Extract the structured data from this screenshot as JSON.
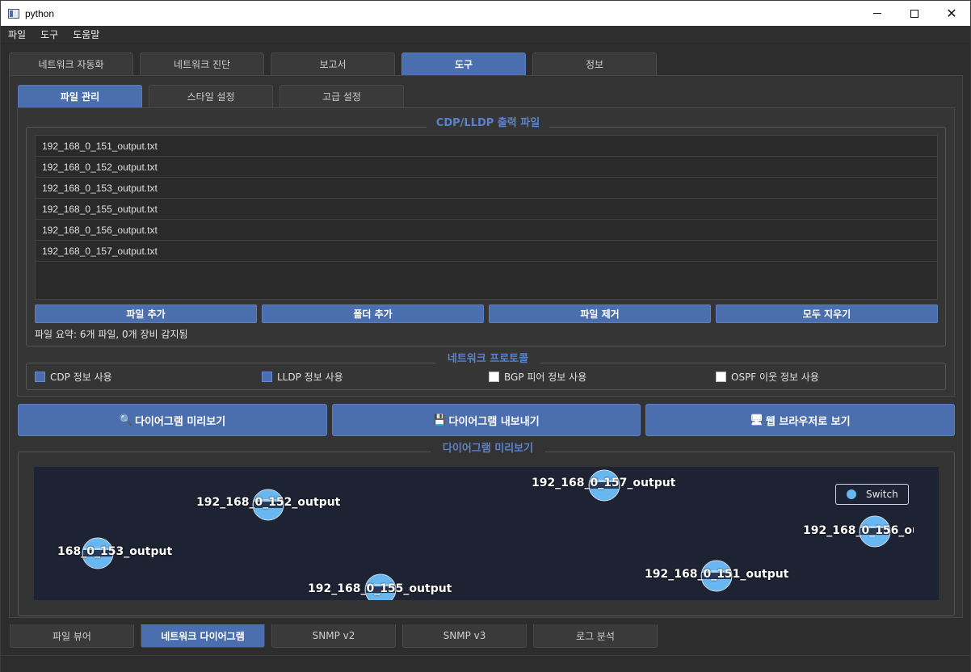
{
  "window": {
    "title": "python"
  },
  "menu": [
    "파일",
    "도구",
    "도움말"
  ],
  "main_tabs": [
    {
      "label": "네트워크 자동화",
      "active": false
    },
    {
      "label": "네트워크 진단",
      "active": false
    },
    {
      "label": "보고서",
      "active": false
    },
    {
      "label": "도구",
      "active": true
    },
    {
      "label": "정보",
      "active": false
    }
  ],
  "sub_tabs": [
    {
      "label": "파일 관리",
      "active": true
    },
    {
      "label": "스타일 설정",
      "active": false
    },
    {
      "label": "고급 설정",
      "active": false
    }
  ],
  "files_group": {
    "title": "CDP/LLDP 출력 파일",
    "files": [
      "192_168_0_151_output.txt",
      "192_168_0_152_output.txt",
      "192_168_0_153_output.txt",
      "192_168_0_155_output.txt",
      "192_168_0_156_output.txt",
      "192_168_0_157_output.txt"
    ],
    "buttons": {
      "add_file": "파일 추가",
      "add_folder": "폴더 추가",
      "remove_file": "파일 제거",
      "clear_all": "모두 지우기"
    },
    "summary": "파일 요약: 6개 파일, 0개 장비 감지됨"
  },
  "protocol_group": {
    "title": "네트워크 프로토콜",
    "options": [
      {
        "label": "CDP 정보 사용",
        "checked": true
      },
      {
        "label": "LLDP 정보 사용",
        "checked": true
      },
      {
        "label": "BGP 피어 정보 사용",
        "checked": false
      },
      {
        "label": "OSPF 이웃 정보 사용",
        "checked": false
      }
    ]
  },
  "actions": {
    "preview": "다이어그램 미리보기",
    "export": "다이어그램 내보내기",
    "browser": "웹 브라우저로 보기"
  },
  "preview_group": {
    "title": "다이어그램 미리보기",
    "legend": "Switch",
    "nodes": [
      {
        "label": "192_168_0_152_output"
      },
      {
        "label": "168_0_153_output"
      },
      {
        "label": "192_168_0_155_output"
      },
      {
        "label": "192_168_0_157_output"
      },
      {
        "label": "192_168_0_151_output"
      },
      {
        "label": "192_168_0_156_ou"
      }
    ]
  },
  "bottom_tabs": [
    {
      "label": "파일 뷰어",
      "active": false
    },
    {
      "label": "네트워크 다이어그램",
      "active": true
    },
    {
      "label": "SNMP v2",
      "active": false
    },
    {
      "label": "SNMP v3",
      "active": false
    },
    {
      "label": "로그 분석",
      "active": false
    }
  ],
  "colors": {
    "accent": "#4b6eaf",
    "node": "#69b7f0",
    "canvas": "#1e2333"
  }
}
